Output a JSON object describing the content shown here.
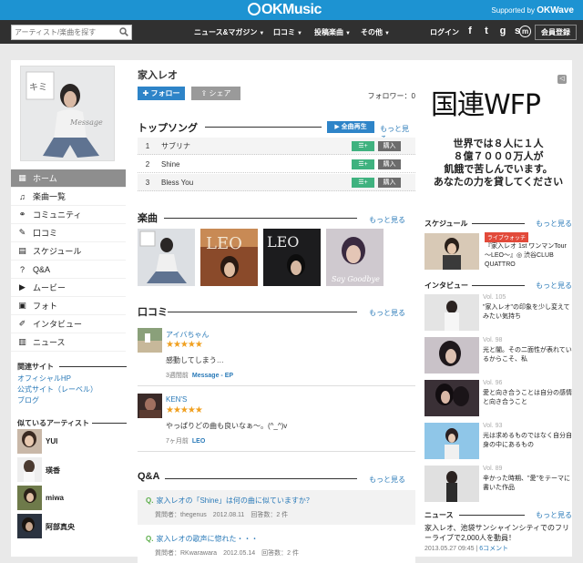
{
  "brand": {
    "name": "OKMusic",
    "supported_by": "Supported by",
    "supporter": "OKWave"
  },
  "nav": {
    "search_placeholder": "アーティスト/楽曲を探す",
    "links": [
      "ニュース&マガジン",
      "口コミ",
      "投稿楽曲",
      "その他"
    ],
    "login": "ログイン",
    "social": [
      "f",
      "t",
      "g",
      "s",
      "m"
    ],
    "register": "会員登録"
  },
  "sidebar": {
    "items": [
      {
        "label": "ホーム",
        "icon": "grid-icon"
      },
      {
        "label": "楽曲一覧",
        "icon": "music-list-icon"
      },
      {
        "label": "コミュニティ",
        "icon": "community-icon"
      },
      {
        "label": "口コミ",
        "icon": "pencil-icon"
      },
      {
        "label": "スケジュール",
        "icon": "calendar-icon"
      },
      {
        "label": "Q&A",
        "icon": "question-icon"
      },
      {
        "label": "ムービー",
        "icon": "movie-icon"
      },
      {
        "label": "フォト",
        "icon": "photo-icon"
      },
      {
        "label": "インタビュー",
        "icon": "mic-icon"
      },
      {
        "label": "ニュース",
        "icon": "news-icon"
      }
    ],
    "related_title": "関連サイト",
    "related_links": [
      "オフィシャルHP",
      "公式サイト（レーベル）",
      "ブログ"
    ],
    "similar_title": "似ているアーティスト",
    "similar": [
      "YUI",
      "瑛香",
      "miwa",
      "阿部真央"
    ]
  },
  "artist": {
    "name": "家入レオ",
    "follow": "フォロー",
    "share": "シェア",
    "followers_label": "フォロワー：0"
  },
  "top_songs": {
    "title": "トップソング",
    "play_all": "全曲再生",
    "more": "もっと見る",
    "songs": [
      {
        "num": "1",
        "title": "サブリナ"
      },
      {
        "num": "2",
        "title": "Shine"
      },
      {
        "num": "3",
        "title": "Bless You"
      }
    ],
    "add_label": "☰+",
    "buy_label": "購入"
  },
  "albums": {
    "title": "楽曲",
    "more": "もっと見る"
  },
  "reviews": {
    "title": "口コミ",
    "more": "もっと見る",
    "items": [
      {
        "user": "アイバちゃん",
        "stars": "★★★★★",
        "text": "感動してしまう…",
        "time": "3週間前",
        "work": "Message - EP"
      },
      {
        "user": "KEN'S",
        "stars": "★★★★★",
        "text": "やっぱりどの曲も良いなぁ～。(^_^)v",
        "time": "7ヶ月前",
        "work": "LEO"
      }
    ]
  },
  "qa": {
    "title": "Q&A",
    "more": "もっと見る",
    "items": [
      {
        "q": "家入レオの「Shine」は何の曲に似ていますか？",
        "meta": "質問者：thegenus　2012.08.11　回答数：2 件"
      },
      {
        "q": "家入レオの歌声に惚れた・・・",
        "meta": "質問者：RKwarawara　2012.05.14　回答数：2 件"
      }
    ]
  },
  "ad": {
    "headline": "国連WFP",
    "lines": [
      "世界では８人に１人",
      "８億７０００万人が",
      "飢餓で苦しんでいます。",
      "あなたの力を貸してください"
    ]
  },
  "schedule": {
    "title": "スケジュール",
    "more": "もっと見る",
    "badge": "ライブウォッチ",
    "text": "『家入レオ 1st ワンマンTour ～LEO～』◎ 渋谷CLUB QUATTRO"
  },
  "interviews": {
    "title": "インタビュー",
    "more": "もっと見る",
    "items": [
      {
        "vol": "Vol. 105",
        "text": "\"家入レオ\"の印象を少し変えてみたい気持ち"
      },
      {
        "vol": "Vol. 98",
        "text": "光と闇。その二面性が表れているからこそ、私"
      },
      {
        "vol": "Vol. 96",
        "text": "愛と向き合うことは自分の感情と向き合うこと"
      },
      {
        "vol": "Vol. 93",
        "text": "光は求めるものではなく自分自身の中にあるもの"
      },
      {
        "vol": "Vol. 89",
        "text": "辛かった時期、\"愛\"をテーマに書いた作品"
      }
    ]
  },
  "news": {
    "title": "ニュース",
    "more": "もっと見る",
    "text": "家入レオ、池袋サンシャインシティでのフリーライブで2,000人を動員！",
    "date": "2013.05.27 09:45",
    "comments": "6コメント"
  },
  "colors": {
    "brand_blue": "#1d93d2",
    "nav_dark": "#303030",
    "accent_blue": "#2e84c8",
    "add_green": "#3fb27f",
    "star": "#f0a020"
  }
}
